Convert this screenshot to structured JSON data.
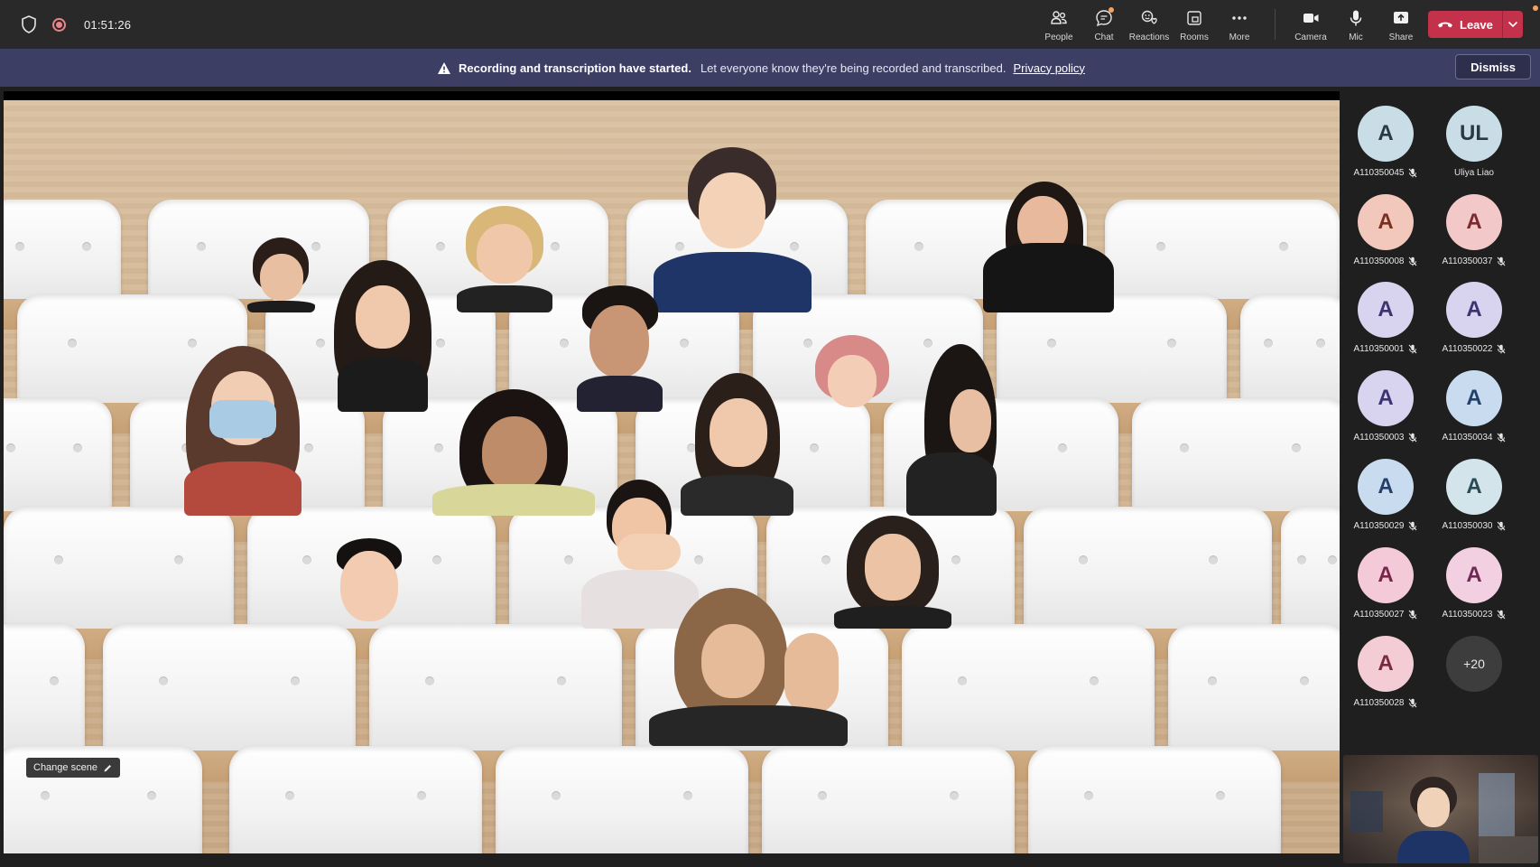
{
  "topbar": {
    "timer": "01:51:26",
    "actions": [
      {
        "id": "people",
        "label": "People",
        "icon": "people-icon"
      },
      {
        "id": "chat",
        "label": "Chat",
        "icon": "chat-icon"
      },
      {
        "id": "reactions",
        "label": "Reactions",
        "icon": "reactions-icon"
      },
      {
        "id": "rooms",
        "label": "Rooms",
        "icon": "rooms-icon"
      },
      {
        "id": "more",
        "label": "More",
        "icon": "more-icon"
      }
    ],
    "devices": [
      {
        "id": "camera",
        "label": "Camera",
        "icon": "camera-icon"
      },
      {
        "id": "mic",
        "label": "Mic",
        "icon": "mic-icon"
      },
      {
        "id": "share",
        "label": "Share",
        "icon": "share-icon"
      }
    ],
    "leave_label": "Leave"
  },
  "banner": {
    "title": "Recording and transcription have started.",
    "message": "Let everyone know they're being recorded and transcribed.",
    "link": "Privacy policy",
    "dismiss_label": "Dismiss"
  },
  "stage": {
    "change_scene_label": "Change scene"
  },
  "colors": {
    "topbar_bg": "#292929",
    "banner_bg": "#3c3e64",
    "leave_red": "#c4314b",
    "recording_dot": "#e8868b"
  },
  "participants": [
    {
      "initials": "A",
      "name": "A110350045",
      "muted": true,
      "bg": "#c9dde6",
      "fg": "#2a3a44"
    },
    {
      "initials": "UL",
      "name": "Uliya Liao",
      "muted": false,
      "bg": "#c9dde6",
      "fg": "#2a3a44"
    },
    {
      "initials": "A",
      "name": "A110350008",
      "muted": true,
      "bg": "#f2c8bc",
      "fg": "#7a3020"
    },
    {
      "initials": "A",
      "name": "A110350037",
      "muted": true,
      "bg": "#f2c8c8",
      "fg": "#7a2a30"
    },
    {
      "initials": "A",
      "name": "A110350001",
      "muted": true,
      "bg": "#d8d3ee",
      "fg": "#3a3570"
    },
    {
      "initials": "A",
      "name": "A110350022",
      "muted": true,
      "bg": "#d8d3ee",
      "fg": "#3a3570"
    },
    {
      "initials": "A",
      "name": "A110350003",
      "muted": true,
      "bg": "#d8d3ee",
      "fg": "#3a3570"
    },
    {
      "initials": "A",
      "name": "A110350034",
      "muted": true,
      "bg": "#c9dbef",
      "fg": "#22406a"
    },
    {
      "initials": "A",
      "name": "A110350029",
      "muted": true,
      "bg": "#c9dbef",
      "fg": "#22406a"
    },
    {
      "initials": "A",
      "name": "A110350030",
      "muted": true,
      "bg": "#d3e4ea",
      "fg": "#2a4a55"
    },
    {
      "initials": "A",
      "name": "A110350027",
      "muted": true,
      "bg": "#f4c9d8",
      "fg": "#7a2448"
    },
    {
      "initials": "A",
      "name": "A110350023",
      "muted": true,
      "bg": "#f2cfe1",
      "fg": "#6e2a55"
    },
    {
      "initials": "A",
      "name": "A110350028",
      "muted": true,
      "bg": "#f4ccd5",
      "fg": "#7a2a3c"
    }
  ],
  "overflow_count": "+20"
}
